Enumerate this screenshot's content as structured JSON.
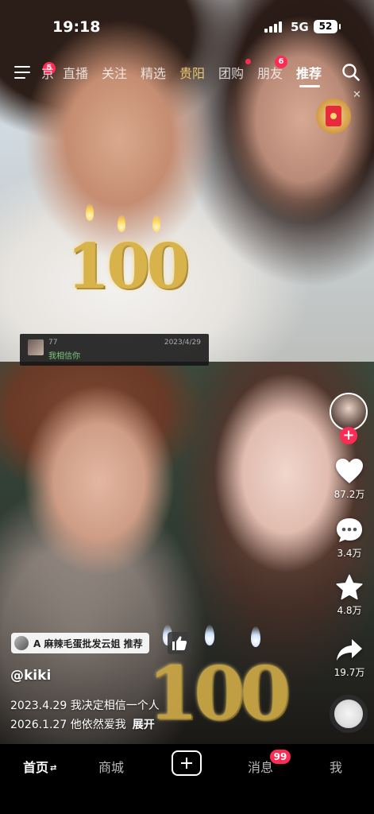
{
  "status_bar": {
    "time": "19:18",
    "network": "5G",
    "battery": "52"
  },
  "top_nav": {
    "menu_badge": "5",
    "tabs": [
      {
        "label": "京"
      },
      {
        "label": "直播"
      },
      {
        "label": "关注"
      },
      {
        "label": "精选"
      },
      {
        "label": "贵阳",
        "highlight": true
      },
      {
        "label": "团购"
      },
      {
        "label": "朋友",
        "badge": "6"
      },
      {
        "label": "推荐",
        "active": true
      }
    ]
  },
  "video": {
    "comment_tag": {
      "user": "77",
      "date": "2023/4/29",
      "text": "我相信你"
    },
    "candles": "100",
    "mini_app": {
      "label": "A 麻辣毛蛋批发云姐 推荐"
    },
    "author": "@kiki",
    "description_line1": "2023.4.29 我决定相信一个人",
    "description_line2": "2026.1.27 他依然爱我",
    "expand_label": "展开"
  },
  "side_rail": {
    "likes": "87.2万",
    "comments": "3.4万",
    "favorites": "4.8万",
    "shares": "19.7万"
  },
  "bottom_nav": {
    "home": "首页",
    "mall": "商城",
    "messages": "消息",
    "messages_badge": "99",
    "me": "我"
  },
  "colors": {
    "accent": "#fe2c55",
    "background": "#000000"
  }
}
